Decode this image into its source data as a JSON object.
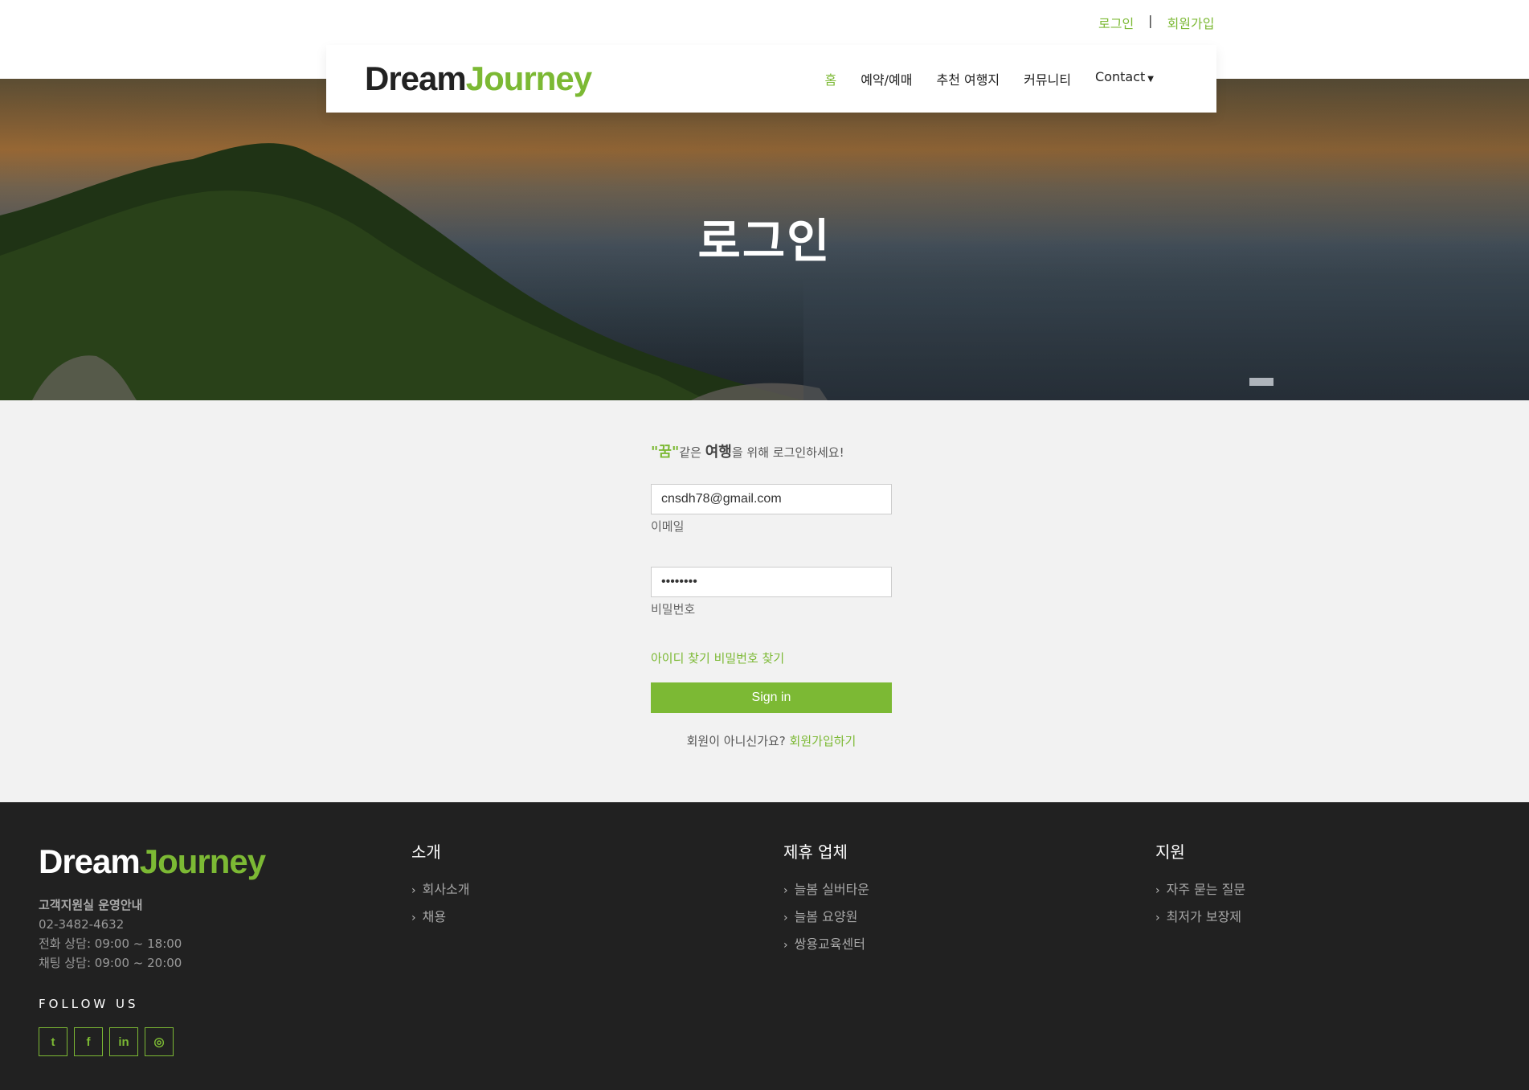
{
  "top_links": {
    "login": "로그인",
    "separator": "|",
    "signup": "회원가입"
  },
  "brand": {
    "dream": "Dream",
    "journey": "Journey",
    "accent_color": "#7cb934"
  },
  "nav": {
    "items": [
      {
        "label": "홈",
        "active": true
      },
      {
        "label": "예약/예매"
      },
      {
        "label": "추천 여행지"
      },
      {
        "label": "커뮤니티"
      },
      {
        "label": "Contact",
        "dropdown": true
      }
    ]
  },
  "hero": {
    "title": "로그인"
  },
  "login": {
    "tagline": {
      "kkum": "\"꿈\"",
      "part1": "같은 ",
      "yeohaeng": "여행",
      "part2": "을 위해 로그인하세요!"
    },
    "email": {
      "value": "cnsdh78@gmail.com",
      "label": "이메일"
    },
    "password": {
      "value": "••••••••",
      "label": "비밀번호"
    },
    "find_id": "아이디 찾기",
    "find_pw": "비밀번호 찾기",
    "submit": "Sign in",
    "not_member": "회원이 아니신가요?",
    "signup_link": "회원가입하기"
  },
  "footer": {
    "info": {
      "title": "고객지원실 운영안내",
      "phone": "02-3482-4632",
      "call_hours": "전화 상담: 09:00 ~ 18:00",
      "chat_hours": "채팅 상담: 09:00 ~ 20:00"
    },
    "follow_us": "FOLLOW US",
    "socials": [
      {
        "icon": "twitter-icon",
        "glyph": "t"
      },
      {
        "icon": "facebook-icon",
        "glyph": "f"
      },
      {
        "icon": "linkedin-icon",
        "glyph": "in"
      },
      {
        "icon": "instagram-icon",
        "glyph": "◎"
      }
    ],
    "columns": [
      {
        "title": "소개",
        "items": [
          "회사소개",
          "채용"
        ]
      },
      {
        "title": "제휴 업체",
        "items": [
          "늘봄 실버타운",
          "늘봄 요양원",
          "쌍용교육센터"
        ]
      },
      {
        "title": "지원",
        "items": [
          "자주 묻는 질문",
          "최저가 보장제"
        ]
      }
    ]
  }
}
